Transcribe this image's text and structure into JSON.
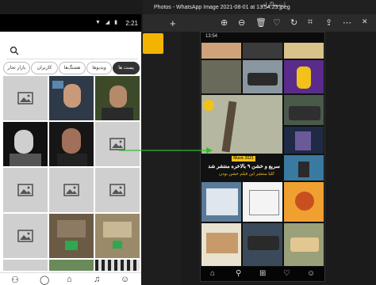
{
  "phone": {
    "status_time": "2:21",
    "status_icons": "▼ ◢ ▮",
    "chips": [
      "پست ها",
      "ویدیوها",
      "هشتگ‌ها",
      "کاربران",
      "بازار تجار"
    ],
    "nav_icons": [
      "users-icon",
      "chat-icon",
      "home-icon",
      "bell-icon",
      "profile-icon"
    ]
  },
  "photos": {
    "top_strip_text": "اینستاگرام",
    "title": "Photos - WhatsApp Image 2021-08-01 at 13.54.23.jpeg",
    "toolbar_icons": [
      "zoom-in-icon",
      "zoom-out-icon",
      "delete-icon",
      "heart-icon",
      "rotate-icon",
      "crop-icon",
      "share-icon",
      "more-icon"
    ],
    "screen": {
      "time": "13:54",
      "caption_title": "سریع و خشن ۹ بالاخره منتشر شد",
      "caption_sub": "کلیا منتشر این فیلم خشن بودن",
      "badge": "Music 2021"
    }
  },
  "colors": {
    "accent": "#f2b400",
    "arrow": "#2fbd2f"
  }
}
